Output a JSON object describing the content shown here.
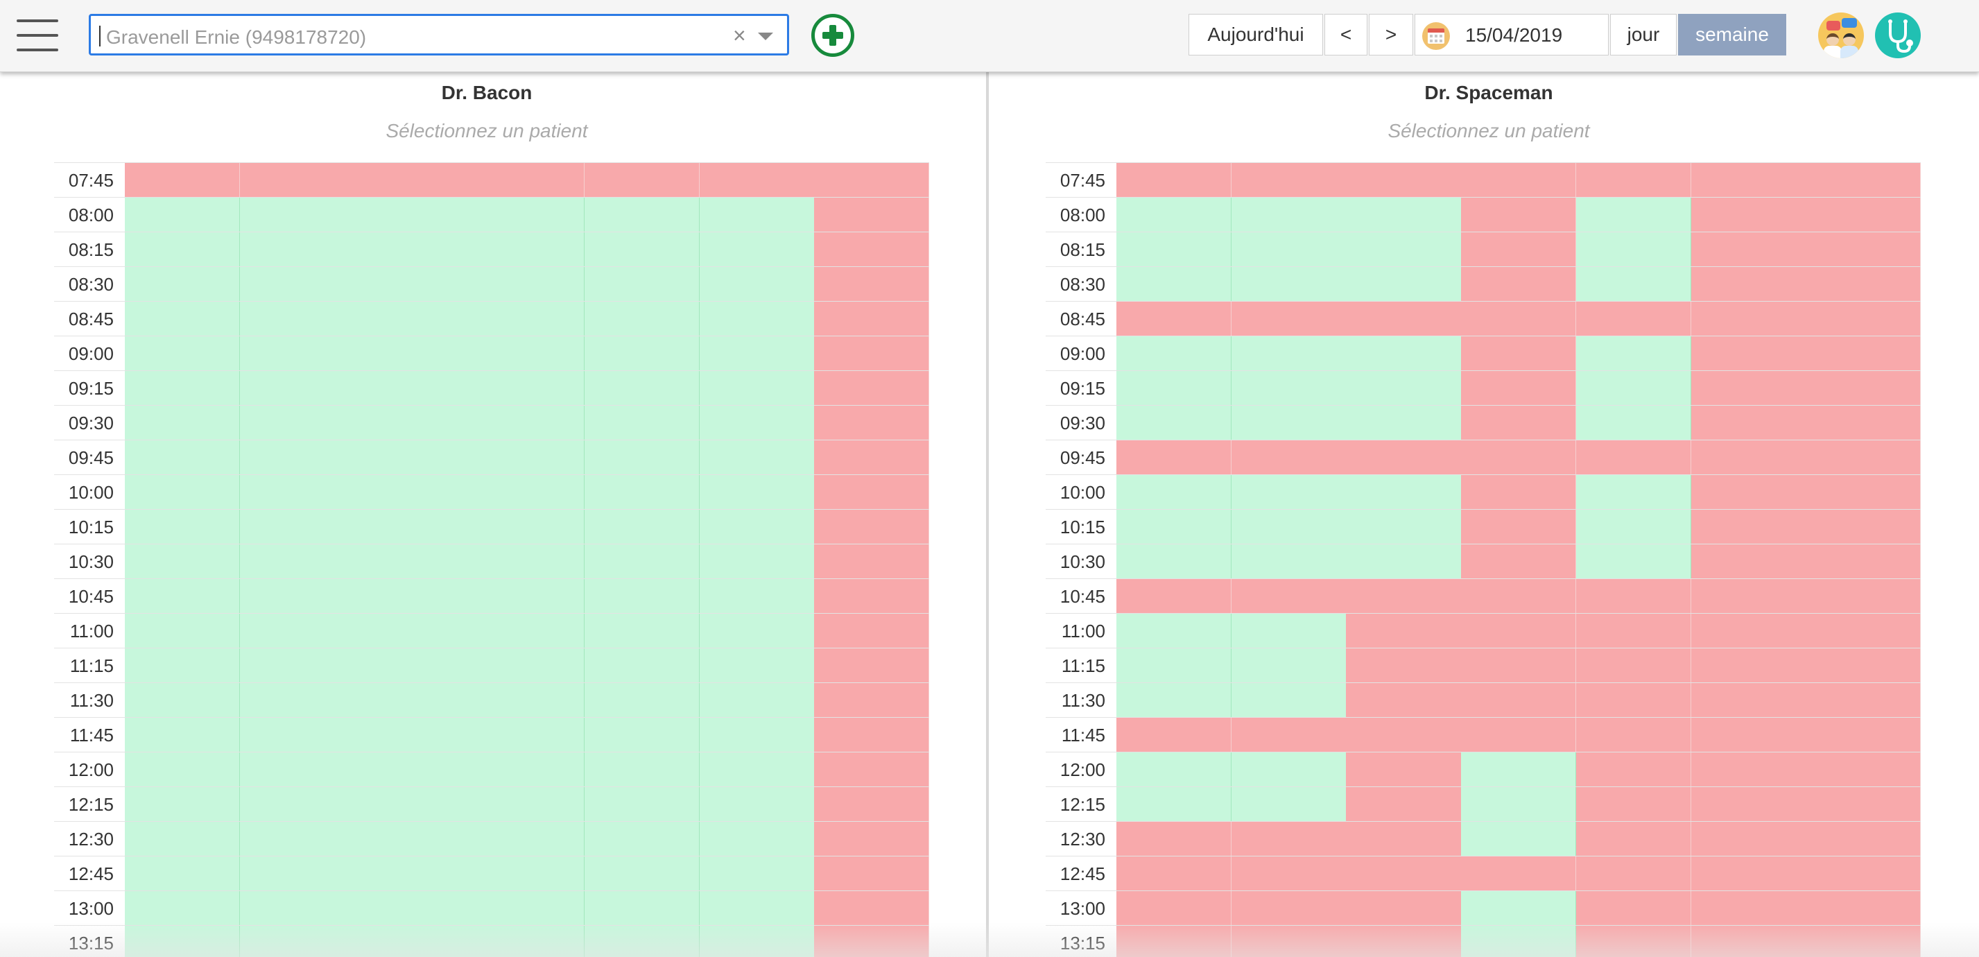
{
  "topbar": {
    "menu_icon": "hamburger-menu-icon",
    "patient_search": {
      "value": "Gravenell Ernie (9498178720)",
      "clear_glyph": "×"
    },
    "add_patient_icon": "plus-circle-icon",
    "today_label": "Aujourd'hui",
    "prev_label": "<",
    "next_label": ">",
    "date_icon": "calendar-icon",
    "date_value": "15/04/2019",
    "view_day_label": "jour",
    "view_week_label": "semaine",
    "active_view": "semaine",
    "avatars": [
      "doctors-avatar-icon",
      "stethoscope-icon"
    ]
  },
  "colors": {
    "free": "#c7f7dc",
    "busy": "#f8a9ab",
    "active_view": "#8fa2bf",
    "add": "#178a3c"
  },
  "times": [
    "07:45",
    "08:00",
    "08:15",
    "08:30",
    "08:45",
    "09:00",
    "09:15",
    "09:30",
    "09:45",
    "10:00",
    "10:15",
    "10:30",
    "10:45",
    "11:00",
    "11:15",
    "11:30",
    "11:45",
    "12:00",
    "12:15",
    "12:30",
    "12:45",
    "13:00",
    "13:15"
  ],
  "panels": [
    {
      "doctor": "Dr. Bacon",
      "hint": "Sélectionnez un patient",
      "slots": [
        "BBBBBBB",
        "FFFFFFB",
        "FFFFFFB",
        "FFFFFFB",
        "FFFFFFB",
        "FFFFFFB",
        "FFFFFFB",
        "FFFFFFB",
        "FFFFFFB",
        "FFFFFFB",
        "FFFFFFB",
        "FFFFFFB",
        "FFFFFFB",
        "FFFFFFB",
        "FFFFFFB",
        "FFFFFFB",
        "FFFFFFB",
        "FFFFFFB",
        "FFFFFFB",
        "FFFFFFB",
        "FFFFFFB",
        "FFFFFFB",
        "FFFFFFB"
      ]
    },
    {
      "doctor": "Dr. Spaceman",
      "hint": "Sélectionnez un patient",
      "slots": [
        "BBBBBBB",
        "FFFBFBB",
        "FFFBFBB",
        "FFFBFBB",
        "BBBBBBB",
        "FFFBFBB",
        "FFFBFBB",
        "FFFBFBB",
        "BBBBBBB",
        "FFFBFBB",
        "FFFBFBB",
        "FFFBFBB",
        "BBBBBBB",
        "FFBBBBB",
        "FFBBBBB",
        "FFBBBBB",
        "BBBBBBB",
        "FFBFBBB",
        "FFBFBBB",
        "BBBFBBB",
        "BBBBBBB",
        "BBBFBBB",
        "BBBFBBB"
      ]
    }
  ]
}
